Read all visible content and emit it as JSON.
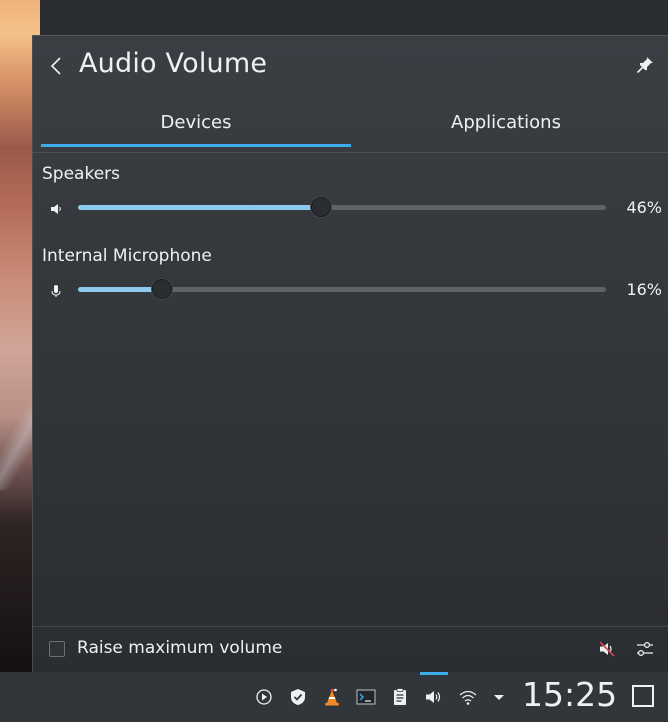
{
  "popup": {
    "title": "Audio Volume",
    "tabs": [
      {
        "label": "Devices",
        "active": true
      },
      {
        "label": "Applications",
        "active": false
      }
    ],
    "devices": [
      {
        "name": "Speakers",
        "icon": "speaker-icon",
        "volume_percent": 46,
        "volume_label": "46%"
      },
      {
        "name": "Internal Microphone",
        "icon": "microphone-icon",
        "volume_percent": 16,
        "volume_label": "16%"
      }
    ],
    "footer": {
      "raise_max_label": "Raise maximum volume",
      "raise_max_checked": false
    }
  },
  "taskbar": {
    "tray_icons": [
      "media-play-icon",
      "shield-check-icon",
      "vlc-cone-icon",
      "terminal-icon",
      "clipboard-icon",
      "volume-icon",
      "wifi-icon",
      "expand-arrow-icon"
    ],
    "clock": "15:25"
  },
  "colors": {
    "accent": "#3daee9",
    "slider_fill": "#8ccbee",
    "panel_bg": "#31363b"
  }
}
